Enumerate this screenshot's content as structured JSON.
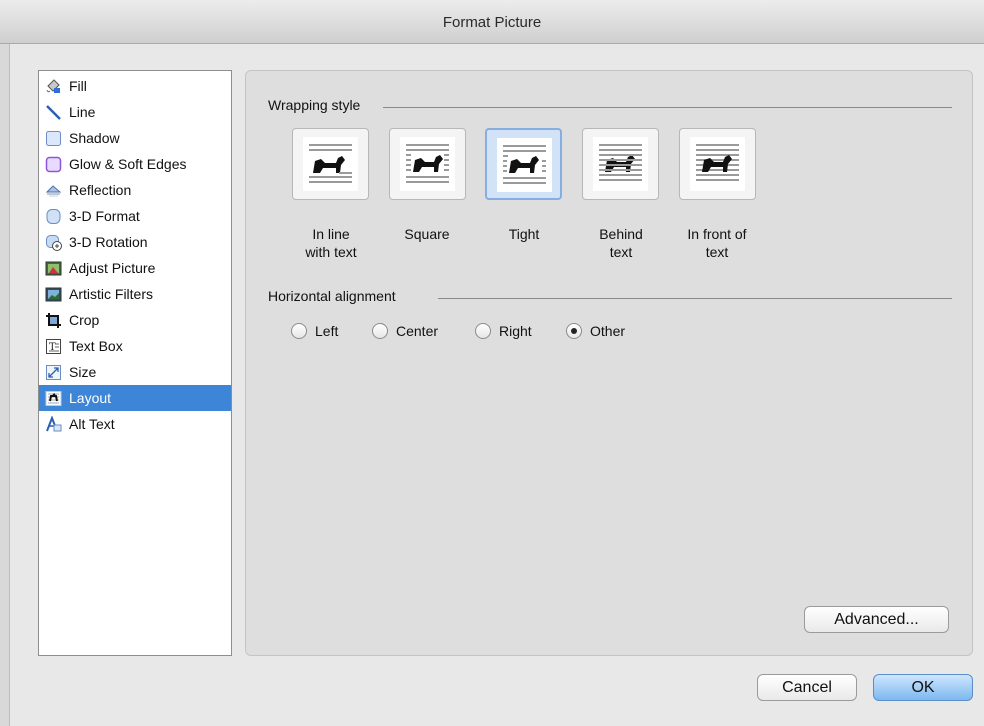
{
  "window": {
    "title": "Format Picture"
  },
  "sidebar": {
    "items": [
      {
        "label": "Fill",
        "icon": "paint-bucket-icon",
        "selected": false
      },
      {
        "label": "Line",
        "icon": "line-icon",
        "selected": false
      },
      {
        "label": "Shadow",
        "icon": "shadow-icon",
        "selected": false
      },
      {
        "label": "Glow & Soft Edges",
        "icon": "glow-icon",
        "selected": false
      },
      {
        "label": "Reflection",
        "icon": "reflection-icon",
        "selected": false
      },
      {
        "label": "3-D Format",
        "icon": "3d-format-icon",
        "selected": false
      },
      {
        "label": "3-D Rotation",
        "icon": "3d-rotation-icon",
        "selected": false
      },
      {
        "label": "Adjust Picture",
        "icon": "adjust-picture-icon",
        "selected": false
      },
      {
        "label": "Artistic Filters",
        "icon": "artistic-filters-icon",
        "selected": false
      },
      {
        "label": "Crop",
        "icon": "crop-icon",
        "selected": false
      },
      {
        "label": "Text Box",
        "icon": "text-box-icon",
        "selected": false
      },
      {
        "label": "Size",
        "icon": "size-icon",
        "selected": false
      },
      {
        "label": "Layout",
        "icon": "layout-icon",
        "selected": true
      },
      {
        "label": "Alt Text",
        "icon": "alt-text-icon",
        "selected": false
      }
    ]
  },
  "wrapping": {
    "label": "Wrapping style",
    "options": [
      {
        "line1": "In line",
        "line2": "with text",
        "icon": "inline-wrap-icon",
        "selected": false
      },
      {
        "line1": "Square",
        "line2": "",
        "icon": "square-wrap-icon",
        "selected": false
      },
      {
        "line1": "Tight",
        "line2": "",
        "icon": "tight-wrap-icon",
        "selected": true
      },
      {
        "line1": "Behind",
        "line2": "text",
        "icon": "behind-text-icon",
        "selected": false
      },
      {
        "line1": "In front of",
        "line2": "text",
        "icon": "in-front-of-text-icon",
        "selected": false
      }
    ]
  },
  "alignment": {
    "label": "Horizontal alignment",
    "options": [
      {
        "label": "Left",
        "checked": false
      },
      {
        "label": "Center",
        "checked": false
      },
      {
        "label": "Right",
        "checked": false
      },
      {
        "label": "Other",
        "checked": true
      }
    ]
  },
  "buttons": {
    "advanced": "Advanced...",
    "cancel": "Cancel",
    "ok": "OK"
  },
  "colors": {
    "selection": "#3d86d7",
    "default_button": "#7cb8ef"
  }
}
